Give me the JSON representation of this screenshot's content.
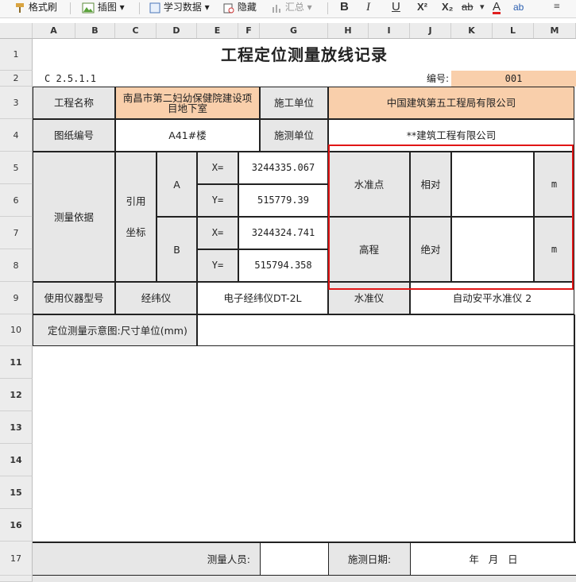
{
  "toolbar": {
    "format_painter": "格式刷",
    "insert_chart": "插图",
    "study_data": "学习数据",
    "hide": "隐藏",
    "summary": "汇总",
    "bold": "B",
    "italic": "I",
    "underline": "U",
    "superscript": "X²",
    "subscript": "X₂",
    "strikethrough": "ab",
    "font_color": "A",
    "phonetic": "ab"
  },
  "columns": [
    "A",
    "B",
    "C",
    "D",
    "E",
    "F",
    "G",
    "H",
    "I",
    "J",
    "K",
    "L",
    "M"
  ],
  "rows": [
    "1",
    "2",
    "3",
    "4",
    "5",
    "6",
    "7",
    "8",
    "9",
    "10",
    "11",
    "12",
    "13",
    "14",
    "15",
    "16",
    "17"
  ],
  "sheet": {
    "title": "工程定位测量放线记录",
    "code": "C 2.5.1.1",
    "number_label": "编号:",
    "number_value": "001",
    "project_name_label": "工程名称",
    "project_name_value": "南昌市第二妇幼保健院建设项目地下室",
    "construction_unit_label": "施工单位",
    "construction_unit_value": "中国建筑第五工程局有限公司",
    "drawing_no_label": "图纸编号",
    "drawing_no_value": "A41#楼",
    "survey_unit_label": "施测单位",
    "survey_unit_value": "**建筑工程有限公司",
    "basis_label": "测量依据",
    "ref_label_1": "引用",
    "ref_label_2": "坐标",
    "point_a": "A",
    "point_b": "B",
    "x_label": "X=",
    "y_label": "Y=",
    "a_x": "3244335.067",
    "a_y": "515779.39",
    "b_x": "3244324.741",
    "b_y": "515794.358",
    "benchmark_label": "水准点",
    "elevation_label": "高程",
    "relative_label": "相对",
    "absolute_label": "绝对",
    "unit_m": "m",
    "instrument_label": "使用仪器型号",
    "theodolite_label": "经纬仪",
    "theodolite_value": "电子经纬仪DT-2L",
    "level_label": "水准仪",
    "level_value": "自动安平水准仪 2",
    "diagram_label": "定位测量示意图:尺寸单位(mm)",
    "surveyor_label": "测量人员:",
    "survey_date_label": "施测日期:",
    "date_value": "年   月   日"
  },
  "colors": {
    "header_fill": "#f9cfab",
    "label_fill": "#e7e7e7",
    "highlight": "#e11616"
  }
}
